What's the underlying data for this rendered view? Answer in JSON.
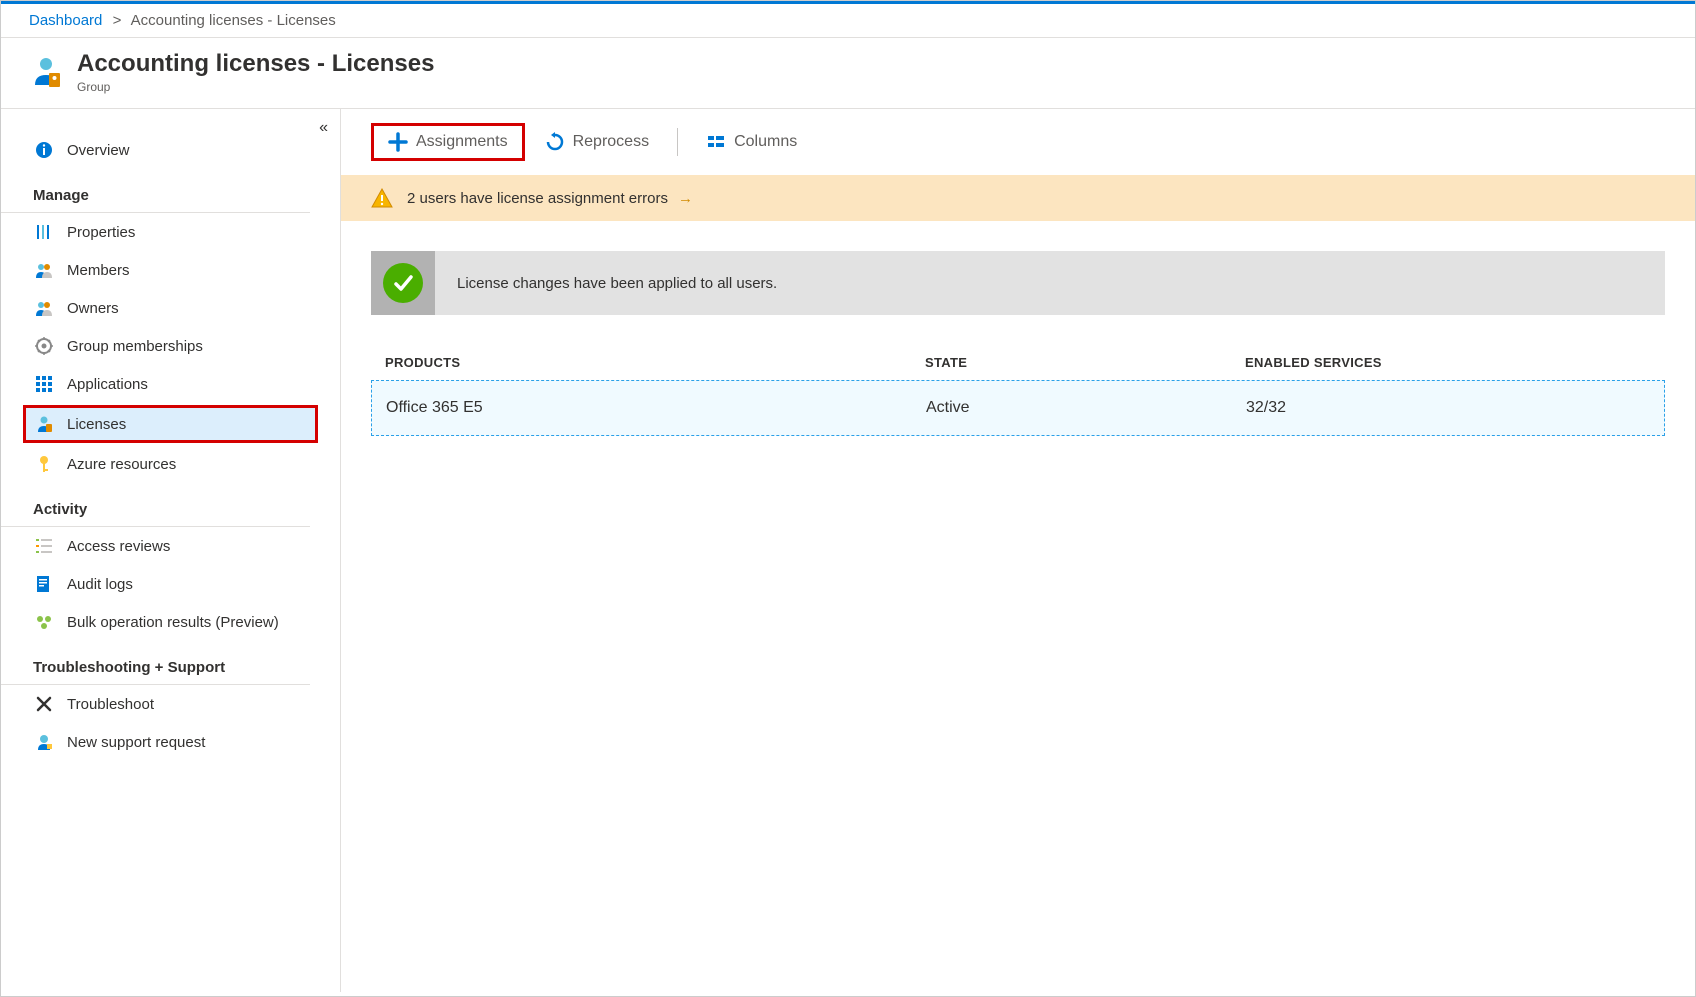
{
  "breadcrumb": {
    "dashboard": "Dashboard",
    "current": "Accounting licenses - Licenses"
  },
  "header": {
    "title": "Accounting licenses - Licenses",
    "subtitle": "Group"
  },
  "sidebar": {
    "overview": "Overview",
    "section_manage": "Manage",
    "properties": "Properties",
    "members": "Members",
    "owners": "Owners",
    "group_memberships": "Group memberships",
    "applications": "Applications",
    "licenses": "Licenses",
    "azure_resources": "Azure resources",
    "section_activity": "Activity",
    "access_reviews": "Access reviews",
    "audit_logs": "Audit logs",
    "bulk_operation": "Bulk operation results (Preview)",
    "section_troubleshoot": "Troubleshooting + Support",
    "troubleshoot": "Troubleshoot",
    "new_support": "New support request"
  },
  "toolbar": {
    "assignments": "Assignments",
    "reprocess": "Reprocess",
    "columns": "Columns"
  },
  "warning": {
    "text": "2 users have license assignment errors"
  },
  "success": {
    "text": "License changes have been applied to all users."
  },
  "table": {
    "head_products": "PRODUCTS",
    "head_state": "STATE",
    "head_services": "ENABLED SERVICES",
    "rows": [
      {
        "product": "Office 365 E5",
        "state": "Active",
        "services": "32/32"
      }
    ]
  }
}
